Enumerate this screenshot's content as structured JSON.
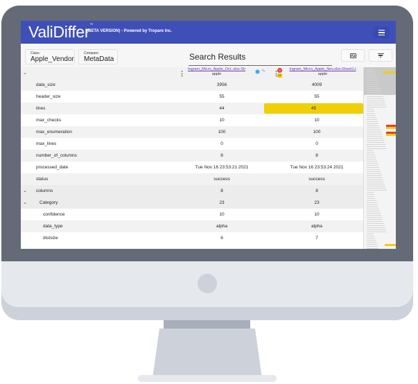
{
  "app": {
    "logo": "ValiDiffer",
    "trademark": "™",
    "tagline": "(BETA VERSION) - Powered by Tropare Inc.",
    "menu_icon": "hamburger-icon"
  },
  "toolbar": {
    "class_label": "Class:",
    "class_value": "Apple_Vendor",
    "compare_label": "Compare:",
    "compare_value": "MetaData",
    "title": "Search Results",
    "expand_icon": "expand-icon",
    "filter_icon": "filter-icon"
  },
  "columns": [
    {
      "file": "Ingram_Micro_Apple_Oct..xlsx:Sh",
      "subtitle": "apple",
      "badges": [
        "info-icon",
        "sparkline-icon"
      ]
    },
    {
      "file": "Ingram_Micro_Apple_Nov.xlsx:Sheet1.t",
      "subtitle": "apple",
      "error_count": "0",
      "warning_count": "22"
    }
  ],
  "rows": [
    {
      "key": "data_size",
      "v1": "3956",
      "v2": "4009"
    },
    {
      "key": "header_size",
      "v1": "55",
      "v2": "55"
    },
    {
      "key": "lines",
      "v1": "44",
      "v2": "45",
      "changed": true
    },
    {
      "key": "max_checks",
      "v1": "10",
      "v2": "10"
    },
    {
      "key": "max_enumeration",
      "v1": "100",
      "v2": "100"
    },
    {
      "key": "max_lines",
      "v1": "0",
      "v2": "0"
    },
    {
      "key": "number_of_columns",
      "v1": "8",
      "v2": "8"
    },
    {
      "key": "processed_date",
      "v1": "Tue Nov 16 23:53:21 2021",
      "v2": "Tue Nov 16 23:53:24 2021"
    },
    {
      "key": "status",
      "v1": "success",
      "v2": "success"
    },
    {
      "key": "columns",
      "v1": "8",
      "v2": "8",
      "expandable": true
    },
    {
      "key": "Category",
      "v1": "23",
      "v2": "23",
      "expandable": true
    },
    {
      "key": "confidence",
      "v1": "10",
      "v2": "10"
    },
    {
      "key": "data_type",
      "v1": "alpha",
      "v2": "alpha"
    },
    {
      "key": "distsize",
      "v1": "6",
      "v2": "7"
    }
  ],
  "colors": {
    "brand": "#3f4fb8",
    "changed_highlight": "#f0cf08",
    "link": "#6a3fb5",
    "error": "#e53935"
  }
}
